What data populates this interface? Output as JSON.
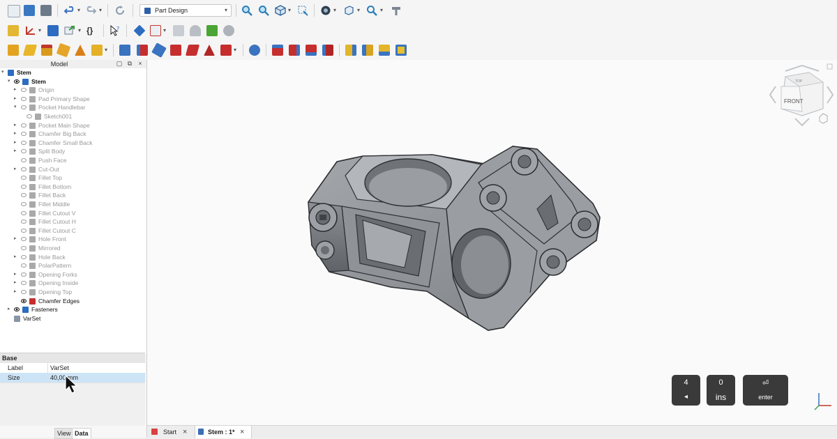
{
  "toolbar": {
    "workbench": "Part Design"
  },
  "model_panel": {
    "title": "Model",
    "tree": [
      {
        "label": "Stem",
        "depth": 0,
        "expander": "open",
        "eye": "none",
        "active": true
      },
      {
        "label": "Stem",
        "depth": 1,
        "expander": "open",
        "eye": "visible",
        "active": true,
        "highlight": "green"
      },
      {
        "label": "Origin",
        "depth": 2,
        "expander": "closed",
        "eye": "hidden",
        "active": false
      },
      {
        "label": "Pad Primary Shape",
        "depth": 2,
        "expander": "closed",
        "eye": "hidden",
        "active": false
      },
      {
        "label": "Pocket Handlebar",
        "depth": 2,
        "expander": "open",
        "eye": "hidden",
        "active": false
      },
      {
        "label": "Sketch001",
        "depth": 3,
        "expander": "none",
        "eye": "hidden",
        "active": false
      },
      {
        "label": "Pocket Main Shape",
        "depth": 2,
        "expander": "closed",
        "eye": "hidden",
        "active": false
      },
      {
        "label": "Chamfer Big Back",
        "depth": 2,
        "expander": "closed",
        "eye": "hidden",
        "active": false
      },
      {
        "label": "Chamfer Small Back",
        "depth": 2,
        "expander": "closed",
        "eye": "hidden",
        "active": false
      },
      {
        "label": "Split Body",
        "depth": 2,
        "expander": "closed",
        "eye": "hidden",
        "active": false
      },
      {
        "label": "Push Face",
        "depth": 2,
        "expander": "none",
        "eye": "hidden",
        "active": false
      },
      {
        "label": "Cut-Out",
        "depth": 2,
        "expander": "closed",
        "eye": "hidden",
        "active": false
      },
      {
        "label": "Fillet Top",
        "depth": 2,
        "expander": "none",
        "eye": "hidden",
        "active": false
      },
      {
        "label": "Fillet Bottom",
        "depth": 2,
        "expander": "none",
        "eye": "hidden",
        "active": false
      },
      {
        "label": "Fillet Back",
        "depth": 2,
        "expander": "none",
        "eye": "hidden",
        "active": false
      },
      {
        "label": "Fillet Middle",
        "depth": 2,
        "expander": "none",
        "eye": "hidden",
        "active": false
      },
      {
        "label": "Fillet Cutout V",
        "depth": 2,
        "expander": "none",
        "eye": "hidden",
        "active": false
      },
      {
        "label": "Fillet Cutout H",
        "depth": 2,
        "expander": "none",
        "eye": "hidden",
        "active": false
      },
      {
        "label": "Fillet Cutout C",
        "depth": 2,
        "expander": "none",
        "eye": "hidden",
        "active": false
      },
      {
        "label": "Hole Front",
        "depth": 2,
        "expander": "closed",
        "eye": "hidden",
        "active": false
      },
      {
        "label": "Mirrored",
        "depth": 2,
        "expander": "none",
        "eye": "hidden",
        "active": false
      },
      {
        "label": "Hole Back",
        "depth": 2,
        "expander": "closed",
        "eye": "hidden",
        "active": false
      },
      {
        "label": "PolarPattern",
        "depth": 2,
        "expander": "none",
        "eye": "hidden",
        "active": false
      },
      {
        "label": "Opening Forks",
        "depth": 2,
        "expander": "closed",
        "eye": "hidden",
        "active": false
      },
      {
        "label": "Opening Inside",
        "depth": 2,
        "expander": "closed",
        "eye": "hidden",
        "active": false
      },
      {
        "label": "Opening Top",
        "depth": 2,
        "expander": "closed",
        "eye": "hidden",
        "active": false
      },
      {
        "label": "Chamfer Edges",
        "depth": 2,
        "expander": "none",
        "eye": "visible",
        "active": true
      },
      {
        "label": "Fasteners",
        "depth": 1,
        "expander": "closed",
        "eye": "visible",
        "active": true
      },
      {
        "label": "VarSet",
        "depth": 1,
        "expander": "none",
        "eye": "none",
        "active": true,
        "highlight": "blue"
      }
    ]
  },
  "properties": {
    "group": "Base",
    "rows": [
      {
        "key": "Label",
        "value": "VarSet",
        "selected": false
      },
      {
        "key": "Size",
        "value": "40,00 mm",
        "selected": true
      }
    ]
  },
  "panel_tabs": {
    "view": "View",
    "data": "Data"
  },
  "doc_tabs": [
    {
      "label": "Start",
      "bold": false
    },
    {
      "label": "Stem : 1*",
      "bold": true
    }
  ],
  "navcube": {
    "face_front": "FRONT",
    "face_top": "TOP"
  },
  "keys": [
    {
      "top": "4",
      "bottom": "◂"
    },
    {
      "top": "0",
      "bottom": "ins"
    },
    {
      "top": "⏎",
      "bottom": "enter"
    }
  ],
  "colors": {
    "accent_green": "#69c22e",
    "selection_blue": "#bcd8f2",
    "part_gray": "#8a8d91"
  }
}
